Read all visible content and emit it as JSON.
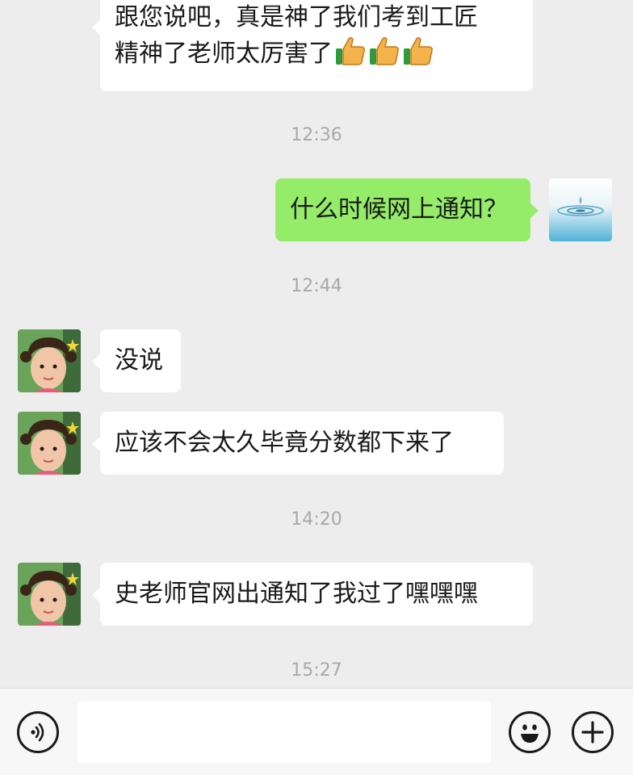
{
  "messages": {
    "msg1_line1": "跟您说吧，真是神了我们考到工匠",
    "msg1_line2": "精神了老师太厉害了",
    "msg1_emojis": [
      "thumbs-up",
      "thumbs-up",
      "thumbs-up"
    ],
    "time1": "12:36",
    "msg2": "什么时候网上通知？",
    "time2": "12:44",
    "msg3": "没说",
    "msg4": "应该不会太久毕竟分数都下来了",
    "time3": "14:20",
    "msg5": "史老师官网出通知了我过了嘿嘿嘿",
    "time4": "15:27"
  },
  "input": {
    "value": ""
  },
  "icons": {
    "voice": "voice-icon",
    "emoji": "emoji-icon",
    "plus": "plus-icon"
  },
  "colors": {
    "background": "#ededed",
    "incoming_bubble": "#ffffff",
    "outgoing_bubble": "#95ec69",
    "timestamp": "#a9a9a9"
  }
}
